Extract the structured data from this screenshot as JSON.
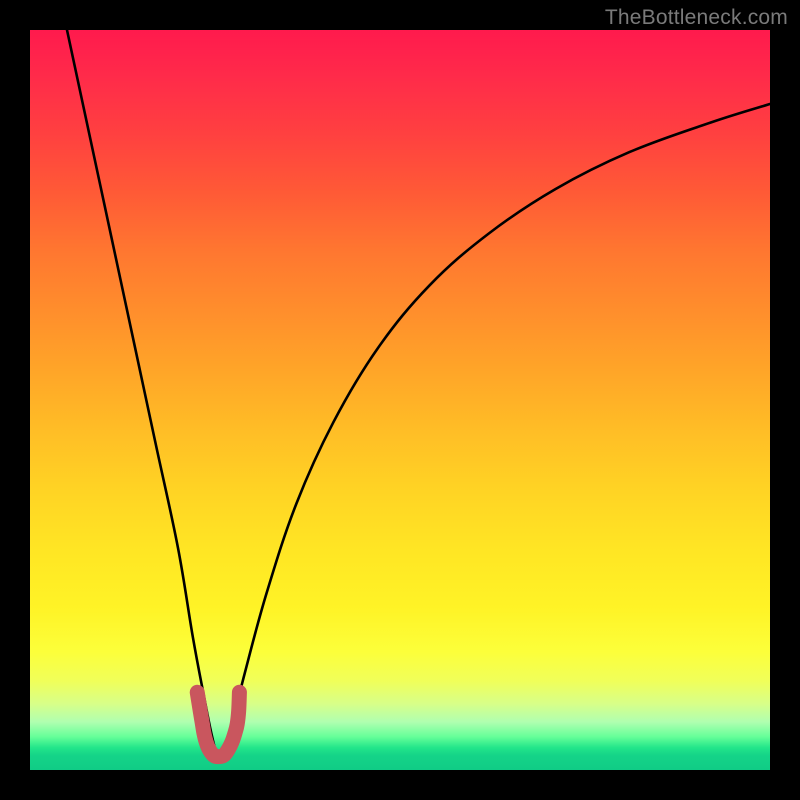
{
  "watermark": "TheBottleneck.com",
  "chart_data": {
    "type": "line",
    "title": "",
    "xlabel": "",
    "ylabel": "",
    "xlim": [
      0,
      100
    ],
    "ylim": [
      0,
      100
    ],
    "grid": false,
    "legend": false,
    "series": [
      {
        "name": "bottleneck-curve",
        "x": [
          5,
          8,
          11,
          14,
          17,
          20,
          22,
          23.5,
          24.5,
          25.3,
          26,
          27,
          29,
          32,
          36,
          41,
          47,
          54,
          62,
          71,
          81,
          92,
          100
        ],
        "y": [
          100,
          86,
          72,
          58,
          44,
          30,
          18,
          10,
          5,
          2,
          2,
          5,
          13,
          24,
          36,
          47,
          57,
          65.5,
          72.5,
          78.5,
          83.5,
          87.5,
          90
        ]
      },
      {
        "name": "valley-marker",
        "x": [
          22.6,
          23.0,
          23.3,
          23.5,
          23.8,
          24.2,
          24.8,
          25.4,
          26.2,
          26.8,
          27.3,
          27.7,
          28.0,
          28.2,
          28.3
        ],
        "y": [
          10.5,
          8.0,
          6.2,
          5.0,
          3.8,
          2.8,
          2.0,
          1.8,
          2.0,
          2.8,
          3.8,
          5.0,
          6.2,
          8.0,
          10.5
        ]
      }
    ],
    "colors": {
      "curve": "#000000",
      "marker": "#c9565e"
    }
  }
}
